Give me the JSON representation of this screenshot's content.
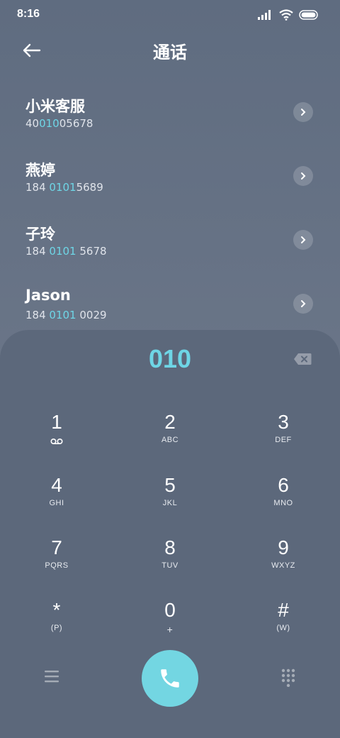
{
  "status": {
    "time": "8:16"
  },
  "header": {
    "title": "通话"
  },
  "contacts": [
    {
      "name": "小米客服",
      "pre": "40",
      "hl": "010",
      "post": "05678"
    },
    {
      "name": "燕婷",
      "pre": "184 ",
      "hl": "0101",
      "post": "5689"
    },
    {
      "name": "子玲",
      "pre": "184 ",
      "hl": "0101",
      "post": " 5678"
    },
    {
      "name": "Jason",
      "pre": "184 ",
      "hl": "0101",
      "post": " 0029"
    }
  ],
  "dialer": {
    "input": "010",
    "keys": [
      {
        "n": "1",
        "l": "voicemail"
      },
      {
        "n": "2",
        "l": "ABC"
      },
      {
        "n": "3",
        "l": "DEF"
      },
      {
        "n": "4",
        "l": "GHI"
      },
      {
        "n": "5",
        "l": "JKL"
      },
      {
        "n": "6",
        "l": "MNO"
      },
      {
        "n": "7",
        "l": "PQRS"
      },
      {
        "n": "8",
        "l": "TUV"
      },
      {
        "n": "9",
        "l": "WXYZ"
      },
      {
        "n": "*",
        "l": "(P)"
      },
      {
        "n": "0",
        "l": "+"
      },
      {
        "n": "#",
        "l": "(W)"
      }
    ]
  },
  "colors": {
    "accent": "#6ed6e6",
    "call_button": "#73d6e2",
    "pad_bg": "#5c687b"
  }
}
